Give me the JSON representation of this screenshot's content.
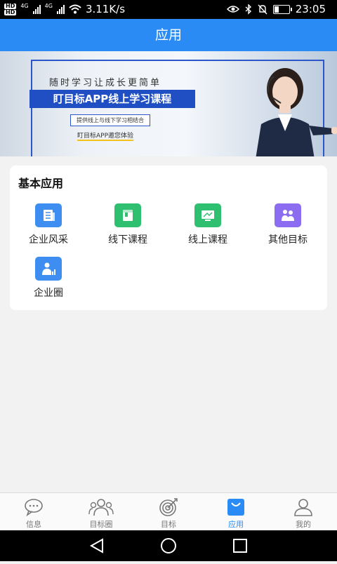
{
  "status": {
    "network_speed": "3.11K/s",
    "net_type_1": "4G",
    "net_type_2": "4G",
    "hd_1": "HD",
    "hd_2": "HD",
    "time": "23:05"
  },
  "header": {
    "title": "应用"
  },
  "banner": {
    "line1": "随时学习让成长更简单",
    "line2": "盯目标APP线上学习课程",
    "line3": "提供线上与线下学习相结合",
    "line4": "盯目标APP邀您体验"
  },
  "section": {
    "title": "基本应用",
    "apps": [
      {
        "label": "企业风采",
        "icon": "newspaper-icon",
        "color": "#3d8ef0"
      },
      {
        "label": "线下课程",
        "icon": "book-icon",
        "color": "#2fbf71"
      },
      {
        "label": "线上课程",
        "icon": "monitor-icon",
        "color": "#2fbf71"
      },
      {
        "label": "其他目标",
        "icon": "people-icon",
        "color": "#8c6cf0"
      },
      {
        "label": "企业圈",
        "icon": "user-chart-icon",
        "color": "#3d8ef0"
      }
    ]
  },
  "tabs": [
    {
      "label": "信息",
      "icon": "chat-bubble-icon"
    },
    {
      "label": "目标圈",
      "icon": "group-icon"
    },
    {
      "label": "目标",
      "icon": "target-icon"
    },
    {
      "label": "应用",
      "icon": "bag-icon",
      "active": true
    },
    {
      "label": "我的",
      "icon": "user-icon"
    }
  ],
  "colors": {
    "primary": "#2b8bf5",
    "inactive": "#777777"
  }
}
